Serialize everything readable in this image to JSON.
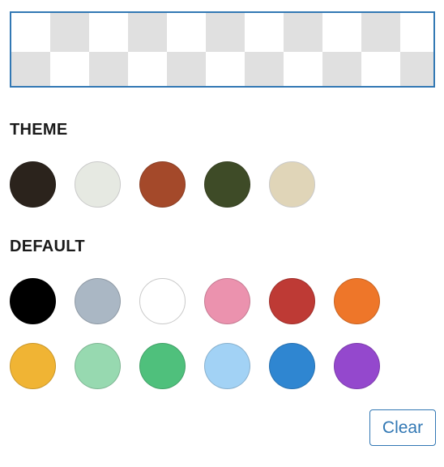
{
  "preview": {
    "name": "current-color-preview",
    "value": "transparent",
    "background_pattern": "checkerboard",
    "checker_light": "#ffffff",
    "checker_dark": "#e0e0e0",
    "border_color": "#3278b4"
  },
  "sections": [
    {
      "id": "theme",
      "title": "THEME",
      "rows": [
        [
          {
            "name": "swatch-theme-dark-brown",
            "color": "#2b231c",
            "outline": "dark"
          },
          {
            "name": "swatch-theme-off-white",
            "color": "#e6e9e2",
            "outline": "light"
          },
          {
            "name": "swatch-theme-rust",
            "color": "#a4492a",
            "outline": "dark"
          },
          {
            "name": "swatch-theme-olive",
            "color": "#3e4b27",
            "outline": "dark"
          },
          {
            "name": "swatch-theme-tan",
            "color": "#e0d5b8",
            "outline": "light"
          }
        ]
      ]
    },
    {
      "id": "default",
      "title": "DEFAULT",
      "rows": [
        [
          {
            "name": "swatch-default-black",
            "color": "#000000",
            "outline": "dark"
          },
          {
            "name": "swatch-default-blue-gray",
            "color": "#aab7c4",
            "outline": "dark"
          },
          {
            "name": "swatch-default-white",
            "color": "#ffffff",
            "outline": "light"
          },
          {
            "name": "swatch-default-pink",
            "color": "#eb92ae",
            "outline": "dark"
          },
          {
            "name": "swatch-default-red",
            "color": "#be3a35",
            "outline": "dark"
          },
          {
            "name": "swatch-default-orange",
            "color": "#ee7629",
            "outline": "dark"
          }
        ],
        [
          {
            "name": "swatch-default-yellow",
            "color": "#f0b434",
            "outline": "dark"
          },
          {
            "name": "swatch-default-mint",
            "color": "#97d9b0",
            "outline": "dark"
          },
          {
            "name": "swatch-default-green",
            "color": "#4fc07c",
            "outline": "dark"
          },
          {
            "name": "swatch-default-light-blue",
            "color": "#a2d2f5",
            "outline": "dark"
          },
          {
            "name": "swatch-default-blue",
            "color": "#2f86d1",
            "outline": "dark"
          },
          {
            "name": "swatch-default-purple",
            "color": "#9448cd",
            "outline": "dark"
          }
        ]
      ]
    }
  ],
  "actions": {
    "clear_label": "Clear",
    "clear_accent": "#3278b4"
  }
}
